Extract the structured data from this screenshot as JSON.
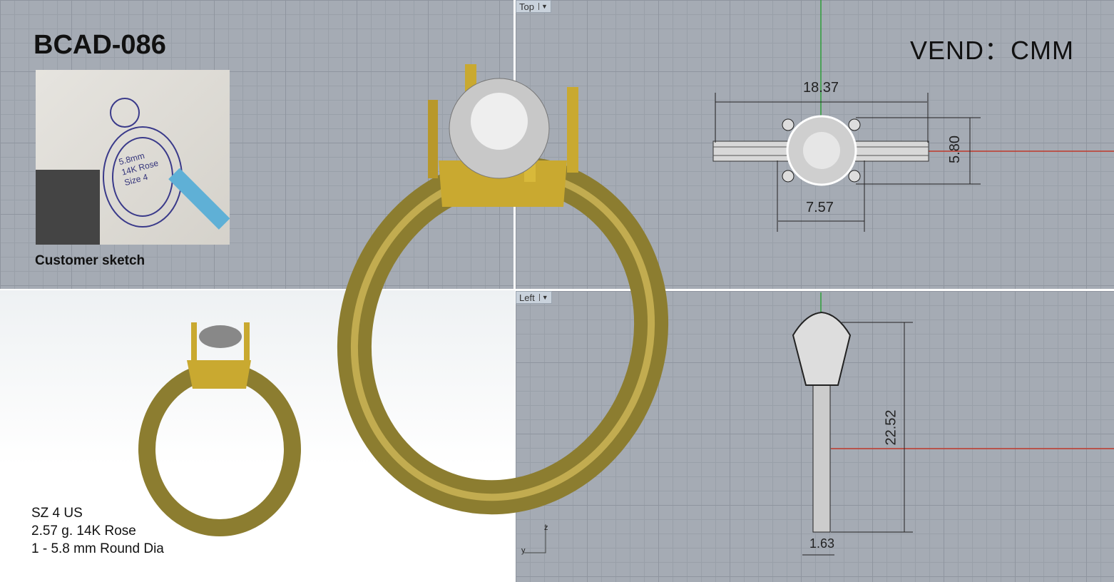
{
  "header": {
    "title": "BCAD-086",
    "vendor": "VEND：CMM"
  },
  "sketch": {
    "caption": "Customer sketch",
    "note_lines": [
      "5.8mm",
      "14K Rose",
      "Size 4"
    ]
  },
  "specs": [
    "SZ 4 US",
    "2.57 g. 14K Rose",
    "1 - 5.8 mm Round Dia"
  ],
  "viewports": {
    "top": {
      "label": "Top",
      "dimensions": {
        "width": "18.37",
        "height": "5.80",
        "head": "7.57"
      }
    },
    "left": {
      "label": "Left",
      "dimensions": {
        "height": "22.52",
        "band": "1.63"
      },
      "axis_labels": [
        "z",
        "y"
      ]
    }
  },
  "colors": {
    "grid": "#a5abb4",
    "gold": "#b8a040",
    "x_axis": "#c0392b",
    "y_axis": "#2e9e3a"
  }
}
